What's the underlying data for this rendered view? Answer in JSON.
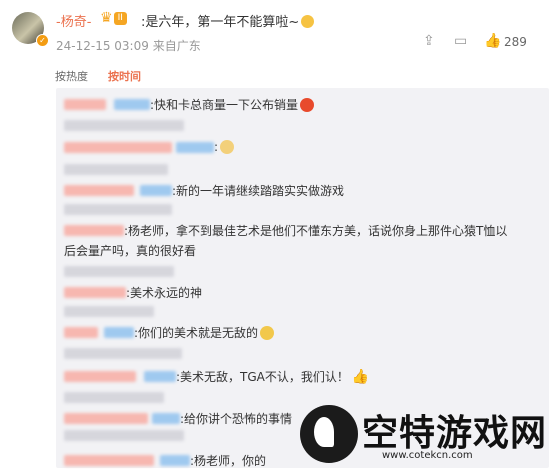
{
  "post": {
    "author": "-杨奇-",
    "badge_level": "II",
    "text": ":是六年，第一年不能算啦~",
    "date": "24-12-15 03:09",
    "source": "来自广东",
    "like_count": "289",
    "icons": [
      "share-icon",
      "comment-icon",
      "like-icon"
    ]
  },
  "sort": {
    "hot": "按热度",
    "time": "按时间"
  },
  "comments": [
    {
      "text": ":快和卡总商量一下公布销量",
      "emoji": "angry-face-icon"
    },
    {
      "text": ""
    },
    {
      "text": ":",
      "emoji": "cat-face-icon"
    },
    {
      "text": ""
    },
    {
      "text": ":新的一年请继续踏踏实实做游戏"
    },
    {
      "text": ""
    },
    {
      "text": ":杨老师，拿不到最佳艺术是他们不懂东方美，话说你身上那件心猿T恤以"
    },
    {
      "text": "后会量产吗，真的很好看"
    },
    {
      "text": ""
    },
    {
      "text": ":美术永远的神"
    },
    {
      "text": ""
    },
    {
      "text": ":你们的美术就是无敌的",
      "emoji": "crying-face-icon"
    },
    {
      "text": ""
    },
    {
      "text": ":美术无敌，TGA不认，我们认！",
      "emoji": "thumbs-up-icon"
    },
    {
      "text": ""
    },
    {
      "text": ":给你讲个恐怖的事情"
    },
    {
      "text": ""
    },
    {
      "text": ":杨老师，你的"
    }
  ],
  "watermark": {
    "title": "空特游戏网",
    "url": "www.cotekcn.com"
  }
}
